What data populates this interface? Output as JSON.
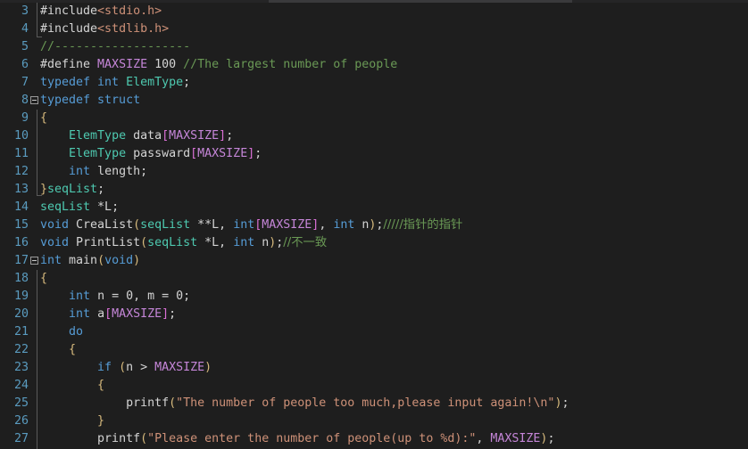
{
  "editor": {
    "theme": "dark",
    "language": "c",
    "first_line": 3,
    "last_line": 27,
    "colors": {
      "background": "#1e1e1e",
      "line_number": "#5a9bbf",
      "plain_text": "#d4d4d4",
      "keyword": "#569cd6",
      "type": "#4ec9b0",
      "macro": "#c586d8",
      "string": "#ce9178",
      "comment": "#6a9955",
      "bracket": "#d7ba7d",
      "indent_guide": "#5a5a5a"
    }
  },
  "gutter": {
    "line_numbers": [
      3,
      4,
      5,
      6,
      7,
      8,
      9,
      10,
      11,
      12,
      13,
      14,
      15,
      16,
      17,
      18,
      19,
      20,
      21,
      22,
      23,
      24,
      25,
      26,
      27
    ],
    "fold_markers": [
      {
        "line": 8,
        "state": "expanded",
        "glyph": "minus-square"
      },
      {
        "line": 17,
        "state": "expanded",
        "glyph": "minus-square"
      }
    ]
  },
  "lines": [
    {
      "n": 3,
      "text": "#include<stdio.h>"
    },
    {
      "n": 4,
      "text": "#include<stdlib.h>"
    },
    {
      "n": 5,
      "text": "//-------------------"
    },
    {
      "n": 6,
      "text": "#define MAXSIZE 100 //The largest number of people"
    },
    {
      "n": 7,
      "text": "typedef int ElemType;"
    },
    {
      "n": 8,
      "text": "typedef struct"
    },
    {
      "n": 9,
      "text": "{"
    },
    {
      "n": 10,
      "text": "    ElemType data[MAXSIZE];"
    },
    {
      "n": 11,
      "text": "    ElemType passward[MAXSIZE];"
    },
    {
      "n": 12,
      "text": "    int length;"
    },
    {
      "n": 13,
      "text": "}seqList;"
    },
    {
      "n": 14,
      "text": "seqList *L;"
    },
    {
      "n": 15,
      "text": "void CreaList(seqList **L, int[MAXSIZE], int n);/////指针的指针"
    },
    {
      "n": 16,
      "text": "void PrintList(seqList *L, int n);//不一致"
    },
    {
      "n": 17,
      "text": "int main(void)"
    },
    {
      "n": 18,
      "text": "{"
    },
    {
      "n": 19,
      "text": "    int n = 0, m = 0;"
    },
    {
      "n": 20,
      "text": "    int a[MAXSIZE];"
    },
    {
      "n": 21,
      "text": "    do"
    },
    {
      "n": 22,
      "text": "    {"
    },
    {
      "n": 23,
      "text": "        if (n > MAXSIZE)"
    },
    {
      "n": 24,
      "text": "        {"
    },
    {
      "n": 25,
      "text": "            printf(\"The number of people too much,please input again!\\n\");"
    },
    {
      "n": 26,
      "text": "        }"
    },
    {
      "n": 27,
      "text": "        printf(\"Please enter the number of people(up to %d):\", MAXSIZE);"
    }
  ],
  "tokens": {
    "l3": [
      {
        "t": "#include",
        "c": "pl"
      },
      {
        "t": "<stdio.h>",
        "c": "str"
      }
    ],
    "l4": [
      {
        "t": "#include",
        "c": "pl"
      },
      {
        "t": "<stdlib.h>",
        "c": "str"
      }
    ],
    "l5": [
      {
        "t": "//-------------------",
        "c": "com"
      }
    ],
    "l6": [
      {
        "t": "#define ",
        "c": "pl"
      },
      {
        "t": "MAXSIZE",
        "c": "mac"
      },
      {
        "t": " 100 ",
        "c": "num"
      },
      {
        "t": "//The largest number of people",
        "c": "com"
      }
    ],
    "l7": [
      {
        "t": "typedef int ",
        "c": "kw"
      },
      {
        "t": "ElemType",
        "c": "ty"
      },
      {
        "t": ";",
        "c": "pl"
      }
    ],
    "l8": [
      {
        "t": "typedef struct",
        "c": "kw"
      }
    ],
    "l9": [
      {
        "t": "{",
        "c": "br"
      }
    ],
    "l10": [
      {
        "t": "ElemType",
        "c": "ty"
      },
      {
        "t": " data",
        "c": "pl"
      },
      {
        "t": "[",
        "c": "br2"
      },
      {
        "t": "MAXSIZE",
        "c": "mac"
      },
      {
        "t": "]",
        "c": "br2"
      },
      {
        "t": ";",
        "c": "pl"
      }
    ],
    "l11": [
      {
        "t": "ElemType",
        "c": "ty"
      },
      {
        "t": " passward",
        "c": "pl"
      },
      {
        "t": "[",
        "c": "br2"
      },
      {
        "t": "MAXSIZE",
        "c": "mac"
      },
      {
        "t": "]",
        "c": "br2"
      },
      {
        "t": ";",
        "c": "pl"
      }
    ],
    "l12": [
      {
        "t": "int",
        "c": "kw"
      },
      {
        "t": " length;",
        "c": "pl"
      }
    ],
    "l13": [
      {
        "t": "}",
        "c": "br"
      },
      {
        "t": "seqList",
        "c": "ty"
      },
      {
        "t": ";",
        "c": "pl"
      }
    ],
    "l14": [
      {
        "t": "seqList",
        "c": "ty"
      },
      {
        "t": " *L;",
        "c": "pl"
      }
    ],
    "l15": [
      {
        "t": "void",
        "c": "kw"
      },
      {
        "t": " CreaList",
        "c": "pl"
      },
      {
        "t": "(",
        "c": "br"
      },
      {
        "t": "seqList",
        "c": "ty"
      },
      {
        "t": " **L, ",
        "c": "pl"
      },
      {
        "t": "int",
        "c": "kw"
      },
      {
        "t": "[",
        "c": "br2"
      },
      {
        "t": "MAXSIZE",
        "c": "mac"
      },
      {
        "t": "]",
        "c": "br2"
      },
      {
        "t": ", ",
        "c": "pl"
      },
      {
        "t": "int",
        "c": "kw"
      },
      {
        "t": " n",
        "c": "pl"
      },
      {
        "t": ")",
        "c": "br"
      },
      {
        "t": ";",
        "c": "pl"
      },
      {
        "t": "/////指针的指针",
        "c": "com"
      }
    ],
    "l16": [
      {
        "t": "void",
        "c": "kw"
      },
      {
        "t": " PrintList",
        "c": "pl"
      },
      {
        "t": "(",
        "c": "br"
      },
      {
        "t": "seqList",
        "c": "ty"
      },
      {
        "t": " *L, ",
        "c": "pl"
      },
      {
        "t": "int",
        "c": "kw"
      },
      {
        "t": " n",
        "c": "pl"
      },
      {
        "t": ")",
        "c": "br"
      },
      {
        "t": ";",
        "c": "pl"
      },
      {
        "t": "//不一致",
        "c": "com"
      }
    ],
    "l17": [
      {
        "t": "int",
        "c": "kw"
      },
      {
        "t": " main",
        "c": "pl"
      },
      {
        "t": "(",
        "c": "br"
      },
      {
        "t": "void",
        "c": "kw"
      },
      {
        "t": ")",
        "c": "br"
      }
    ],
    "l18": [
      {
        "t": "{",
        "c": "br"
      }
    ],
    "l19": [
      {
        "t": "int",
        "c": "kw"
      },
      {
        "t": " n = 0, m = 0;",
        "c": "pl"
      }
    ],
    "l20": [
      {
        "t": "int",
        "c": "kw"
      },
      {
        "t": " a",
        "c": "pl"
      },
      {
        "t": "[",
        "c": "br2"
      },
      {
        "t": "MAXSIZE",
        "c": "mac"
      },
      {
        "t": "]",
        "c": "br2"
      },
      {
        "t": ";",
        "c": "pl"
      }
    ],
    "l21": [
      {
        "t": "do",
        "c": "kw"
      }
    ],
    "l22": [
      {
        "t": "{",
        "c": "br"
      }
    ],
    "l23": [
      {
        "t": "if",
        "c": "kw"
      },
      {
        "t": " ",
        "c": "pl"
      },
      {
        "t": "(",
        "c": "br"
      },
      {
        "t": "n > ",
        "c": "pl"
      },
      {
        "t": "MAXSIZE",
        "c": "mac"
      },
      {
        "t": ")",
        "c": "br"
      }
    ],
    "l24": [
      {
        "t": "{",
        "c": "br"
      }
    ],
    "l25": [
      {
        "t": "printf",
        "c": "pl"
      },
      {
        "t": "(",
        "c": "br"
      },
      {
        "t": "\"The number of people too much,please input again!\\n\"",
        "c": "str"
      },
      {
        "t": ")",
        "c": "br"
      },
      {
        "t": ";",
        "c": "pl"
      }
    ],
    "l26": [
      {
        "t": "}",
        "c": "br"
      }
    ],
    "l27": [
      {
        "t": "printf",
        "c": "pl"
      },
      {
        "t": "(",
        "c": "br"
      },
      {
        "t": "\"Please enter the number of people(up to %d):\"",
        "c": "str"
      },
      {
        "t": ", ",
        "c": "pl"
      },
      {
        "t": "MAXSIZE",
        "c": "mac"
      },
      {
        "t": ")",
        "c": "br"
      },
      {
        "t": ";",
        "c": "pl"
      }
    ]
  },
  "indents": {
    "l3": 0,
    "l4": 0,
    "l5": 0,
    "l6": 0,
    "l7": 0,
    "l8": 0,
    "l9": 0,
    "l10": 4,
    "l11": 4,
    "l12": 4,
    "l13": 0,
    "l14": 0,
    "l15": 0,
    "l16": 0,
    "l17": 0,
    "l18": 0,
    "l19": 4,
    "l20": 4,
    "l21": 4,
    "l22": 4,
    "l23": 8,
    "l24": 8,
    "l25": 12,
    "l26": 8,
    "l27": 8
  }
}
